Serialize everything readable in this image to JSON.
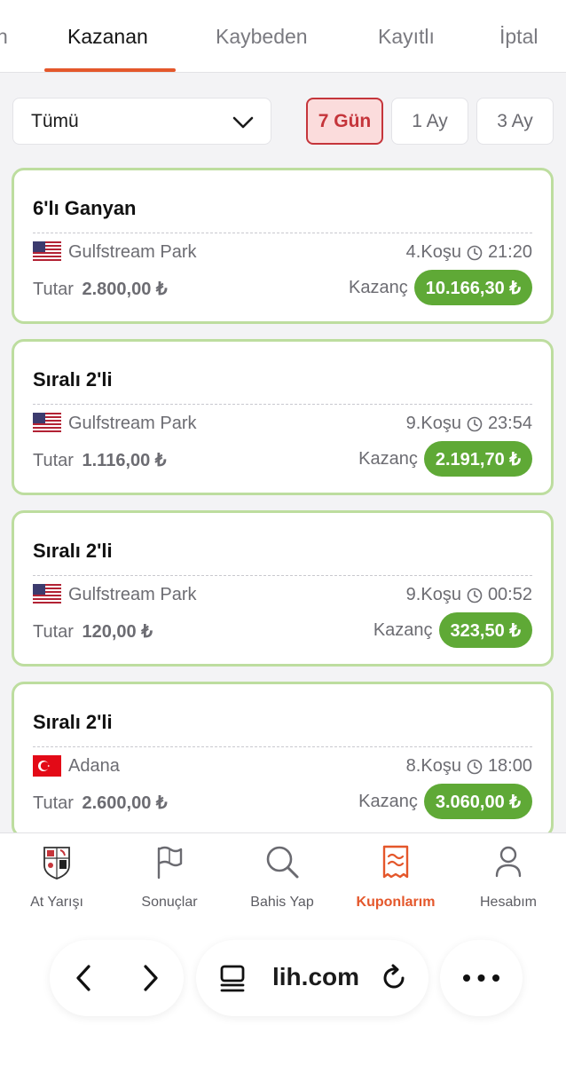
{
  "tabs": [
    "n",
    "Kazanan",
    "Kaybeden",
    "Kayıtlı",
    "İptal"
  ],
  "filter": {
    "dropdown_value": "Tümü",
    "periods": [
      "7 Gün",
      "1 Ay",
      "3 Ay"
    ],
    "active_period": "7 Gün"
  },
  "coupons": [
    {
      "title": "6'lı Ganyan",
      "country": "US",
      "track": "Gulfstream Park",
      "race": "4.Koşu",
      "time": "21:20",
      "stake_label": "Tutar",
      "stake": "2.800,00 ₺",
      "win_label": "Kazanç",
      "win": "10.166,30 ₺"
    },
    {
      "title": "Sıralı 2'li",
      "country": "US",
      "track": "Gulfstream Park",
      "race": "9.Koşu",
      "time": "23:54",
      "stake_label": "Tutar",
      "stake": "1.116,00 ₺",
      "win_label": "Kazanç",
      "win": "2.191,70 ₺"
    },
    {
      "title": "Sıralı 2'li",
      "country": "US",
      "track": "Gulfstream Park",
      "race": "9.Koşu",
      "time": "00:52",
      "stake_label": "Tutar",
      "stake": "120,00 ₺",
      "win_label": "Kazanç",
      "win": "323,50 ₺"
    },
    {
      "title": "Sıralı 2'li",
      "country": "TR",
      "track": "Adana",
      "race": "8.Koşu",
      "time": "18:00",
      "stake_label": "Tutar",
      "stake": "2.600,00 ₺",
      "win_label": "Kazanç",
      "win": "3.060,00 ₺"
    }
  ],
  "bottom_nav": [
    {
      "label": "At Yarışı",
      "icon": "horse-racing-logo-icon",
      "active": false
    },
    {
      "label": "Sonuçlar",
      "icon": "flag-icon",
      "active": false
    },
    {
      "label": "Bahis Yap",
      "icon": "search-icon",
      "active": false
    },
    {
      "label": "Kuponlarım",
      "icon": "ticket-icon",
      "active": true
    },
    {
      "label": "Hesabım",
      "icon": "user-icon",
      "active": false
    }
  ],
  "browser": {
    "url": "lih.com"
  },
  "colors": {
    "accent": "#e4572b",
    "win_green": "#5fa936",
    "card_border": "#bddd9f",
    "period_active": "#c5353b"
  }
}
